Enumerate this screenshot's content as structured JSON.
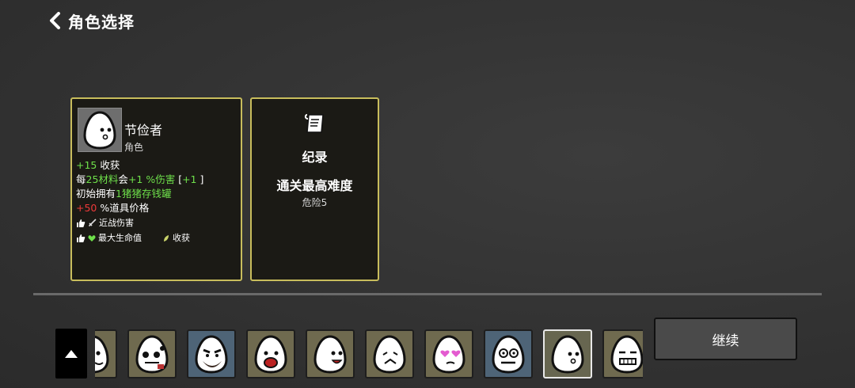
{
  "header": {
    "title": "角色选择"
  },
  "character": {
    "name": "节俭者",
    "type": "角色",
    "stats": [
      {
        "a": "+15",
        "a_color": "green",
        "b": " 收获",
        "c": "",
        "d": "",
        "e": ""
      },
      {
        "a": "每",
        "a_color": "",
        "b": "25材料",
        "b_color": "green",
        "c": "会",
        "d": "+1 %伤害",
        "e": " [+1 ]"
      },
      {
        "a": "初始拥有",
        "a_color": "",
        "b": "1猪猪存钱罐",
        "b_color": "green",
        "c": "",
        "d": "",
        "e": ""
      },
      {
        "a": "+50",
        "a_color": "red",
        "b": " %道具价格",
        "c": "",
        "d": "",
        "e": ""
      }
    ],
    "tags": [
      [
        "近战伤害"
      ],
      [
        "最大生命值",
        "收获"
      ]
    ]
  },
  "record": {
    "title": "纪录",
    "subtitle": "通关最高难度",
    "value": "危险5"
  },
  "roster": {
    "selected_index": 8,
    "slots": [
      {
        "face": "egg-partial",
        "bg": "olive"
      },
      {
        "face": "egg-bandaged",
        "bg": "olive"
      },
      {
        "face": "egg-bearded",
        "bg": "blue"
      },
      {
        "face": "egg-screaming",
        "bg": "olive"
      },
      {
        "face": "egg-happy",
        "bg": "olive"
      },
      {
        "face": "egg-sad",
        "bg": "olive"
      },
      {
        "face": "egg-heart-eyes",
        "bg": "olive"
      },
      {
        "face": "egg-shocked",
        "bg": "blue"
      },
      {
        "face": "egg-plain",
        "bg": "selected"
      },
      {
        "face": "egg-grimace",
        "bg": "olive"
      }
    ]
  },
  "continue_label": "继续",
  "colors": {
    "panel_border": "#c8bd5c",
    "stat_green": "#6ee04a",
    "stat_red": "#ef3a3a"
  }
}
